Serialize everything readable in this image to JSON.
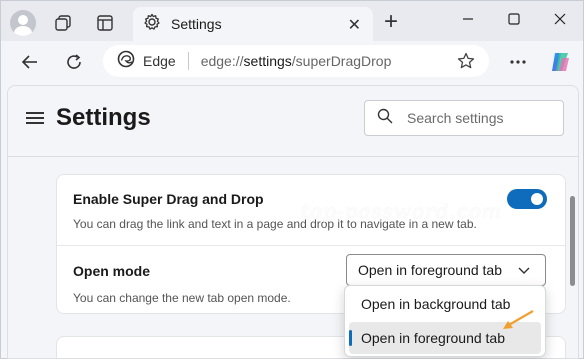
{
  "browser": {
    "tab_title": "Settings",
    "omnibox_brand": "Edge",
    "url_prefix": "edge://",
    "url_strong": "settings",
    "url_suffix": "/superDragDrop"
  },
  "settings": {
    "title": "Settings",
    "search_placeholder": "Search settings",
    "super_drag": {
      "title": "Enable Super Drag and Drop",
      "description": "You can drag the link and text in a page and drop it to navigate in a new tab.",
      "enabled": true
    },
    "open_mode": {
      "title": "Open mode",
      "description": "You can change the new tab open mode.",
      "selected": "Open in foreground tab",
      "options": [
        "Open in background tab",
        "Open in foreground tab"
      ]
    }
  },
  "watermark": "top-password.com",
  "colors": {
    "accent": "#0f6cbd",
    "arrow": "#f0a030"
  }
}
